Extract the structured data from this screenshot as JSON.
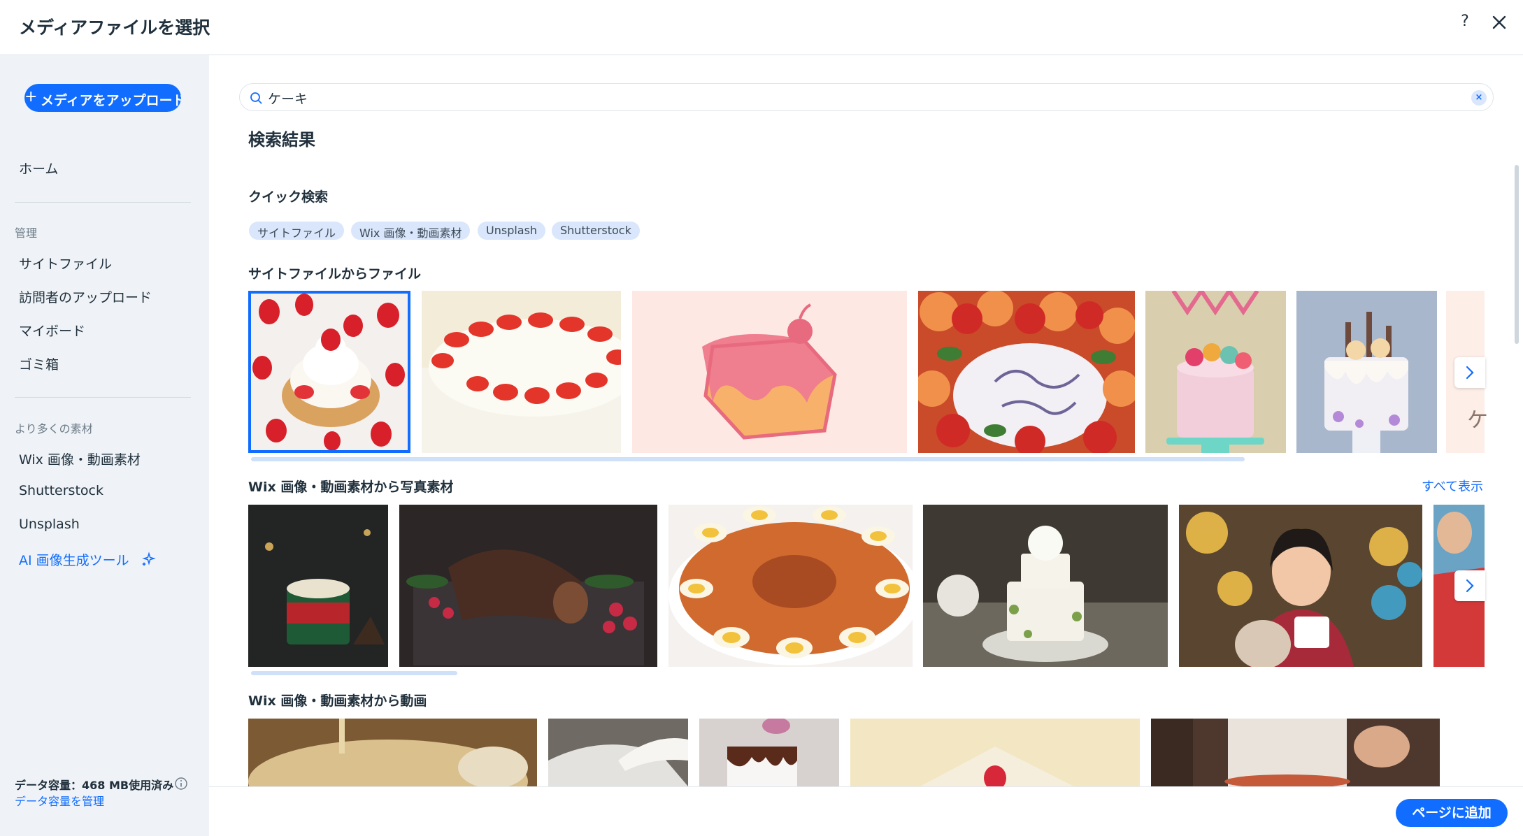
{
  "header": {
    "title": "メディアファイルを選択",
    "help_label": "?"
  },
  "sidebar": {
    "upload_label": "メディアをアップロード",
    "upload_plus": "+",
    "home": "ホーム",
    "manage_section": "管理",
    "manage_items": [
      "サイトファイル",
      "訪問者のアップロード",
      "マイボード",
      "ゴミ箱"
    ],
    "more_section": "より多くの素材",
    "more_items": [
      "Wix 画像・動画素材",
      "Shutterstock",
      "Unsplash",
      "AI 画像生成ツール"
    ],
    "storage_label": "データ容量：468 MB使用済み",
    "storage_link": "データ容量を管理"
  },
  "search": {
    "value": "ケーキ",
    "clear_label": "×"
  },
  "results": {
    "title": "検索結果",
    "quick_search_title": "クイック検索",
    "chips": [
      "サイトファイル",
      "Wix 画像・動画素材",
      "Unsplash",
      "Shutterstock"
    ],
    "site_files_title": "サイトファイルからファイル",
    "site_files_partial_text": "ケ",
    "wix_photos_title": "Wix 画像・動画素材から写真素材",
    "show_all": "すべて表示",
    "wix_videos_title": "Wix 画像・動画素材から動画"
  },
  "footer": {
    "add_label": "ページに追加"
  },
  "colors": {
    "accent": "#116dff",
    "sidebar_bg": "#eff3f7",
    "chip_bg": "#d9e6fb"
  },
  "icons": [
    "help-icon",
    "close-icon",
    "search-icon",
    "info-icon",
    "sparkle-icon",
    "chevron-right-icon"
  ]
}
